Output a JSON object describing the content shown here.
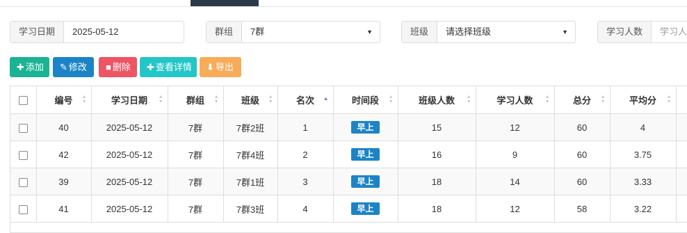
{
  "filters": {
    "date_label": "学习日期",
    "date_value": "2025-05-12",
    "group_label": "群组",
    "group_value": "7群",
    "class_label": "班级",
    "class_placeholder": "请选择班级",
    "study_count_label": "学习人数",
    "study_count_placeholder": "学习人"
  },
  "toolbar": {
    "add_label": "添加",
    "edit_label": "修改",
    "delete_label": "删除",
    "detail_label": "查看详情",
    "export_label": "导出"
  },
  "table": {
    "columns": [
      "编号",
      "学习日期",
      "群组",
      "班级",
      "名次",
      "时间段",
      "班级人数",
      "学习人数",
      "总分",
      "平均分"
    ],
    "sorted_column": "名次",
    "sort_direction": "asc",
    "rows": [
      {
        "id": "40",
        "date": "2025-05-12",
        "group": "7群",
        "class": "7群2班",
        "rank": "1",
        "period": "早上",
        "class_size": "15",
        "study_count": "12",
        "total": "60",
        "avg": "4"
      },
      {
        "id": "42",
        "date": "2025-05-12",
        "group": "7群",
        "class": "7群4班",
        "rank": "2",
        "period": "早上",
        "class_size": "16",
        "study_count": "9",
        "total": "60",
        "avg": "3.75"
      },
      {
        "id": "39",
        "date": "2025-05-12",
        "group": "7群",
        "class": "7群1班",
        "rank": "3",
        "period": "早上",
        "class_size": "18",
        "study_count": "14",
        "total": "60",
        "avg": "3.33"
      },
      {
        "id": "41",
        "date": "2025-05-12",
        "group": "7群",
        "class": "7群3班",
        "rank": "4",
        "period": "早上",
        "class_size": "18",
        "study_count": "12",
        "total": "58",
        "avg": "3.22"
      }
    ]
  },
  "colors": {
    "add": "#1ab394",
    "edit": "#1c84c6",
    "delete": "#ed5565",
    "detail": "#23c6c8",
    "export": "#f8ac59",
    "badge": "#1c84c6"
  }
}
